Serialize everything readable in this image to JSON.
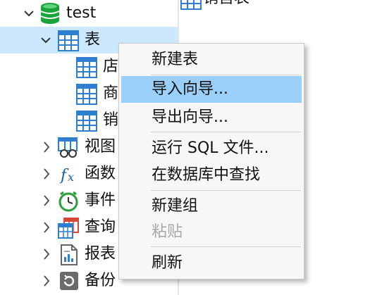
{
  "right_pane": {
    "partial_item": "销售表"
  },
  "tree": [
    {
      "name": "tree-item-test",
      "label": "test",
      "chevron": "expanded",
      "icon": "database-icon"
    },
    {
      "name": "tree-item-tables",
      "label": "表",
      "chevron": "expanded",
      "icon": "table-icon",
      "selected": true
    },
    {
      "name": "tree-item-table-1",
      "label": "店",
      "icon": "table-icon"
    },
    {
      "name": "tree-item-table-2",
      "label": "商",
      "icon": "table-icon"
    },
    {
      "name": "tree-item-table-3",
      "label": "销",
      "icon": "table-icon"
    },
    {
      "name": "tree-item-views",
      "label": "视图",
      "chevron": "collapsed",
      "icon": "view-icon"
    },
    {
      "name": "tree-item-functions",
      "label": "函数",
      "chevron": "collapsed",
      "icon": "function-icon"
    },
    {
      "name": "tree-item-events",
      "label": "事件",
      "chevron": "collapsed",
      "icon": "clock-icon"
    },
    {
      "name": "tree-item-queries",
      "label": "查询",
      "chevron": "collapsed",
      "icon": "query-icon"
    },
    {
      "name": "tree-item-reports",
      "label": "报表",
      "chevron": "collapsed",
      "icon": "report-icon"
    },
    {
      "name": "tree-item-backup",
      "label": "备份",
      "chevron": "collapsed",
      "icon": "backup-icon"
    }
  ],
  "context_menu": {
    "items": [
      {
        "label": "新建表"
      },
      {
        "label": "导入向导...",
        "highlighted": true
      },
      {
        "label": "导出向导..."
      },
      {
        "label": "运行 SQL 文件..."
      },
      {
        "label": "在数据库中查找"
      },
      {
        "label": "新建组"
      },
      {
        "label": "粘贴",
        "disabled": true
      },
      {
        "label": "刷新"
      }
    ]
  },
  "colors": {
    "selection": "#cce8ff",
    "menu_highlight": "#99cff8",
    "menu_background": "#f7f7f7",
    "table_icon": "#2f7fd1",
    "database_icon": "#19a33b",
    "disabled_text": "#a7a7a7"
  }
}
